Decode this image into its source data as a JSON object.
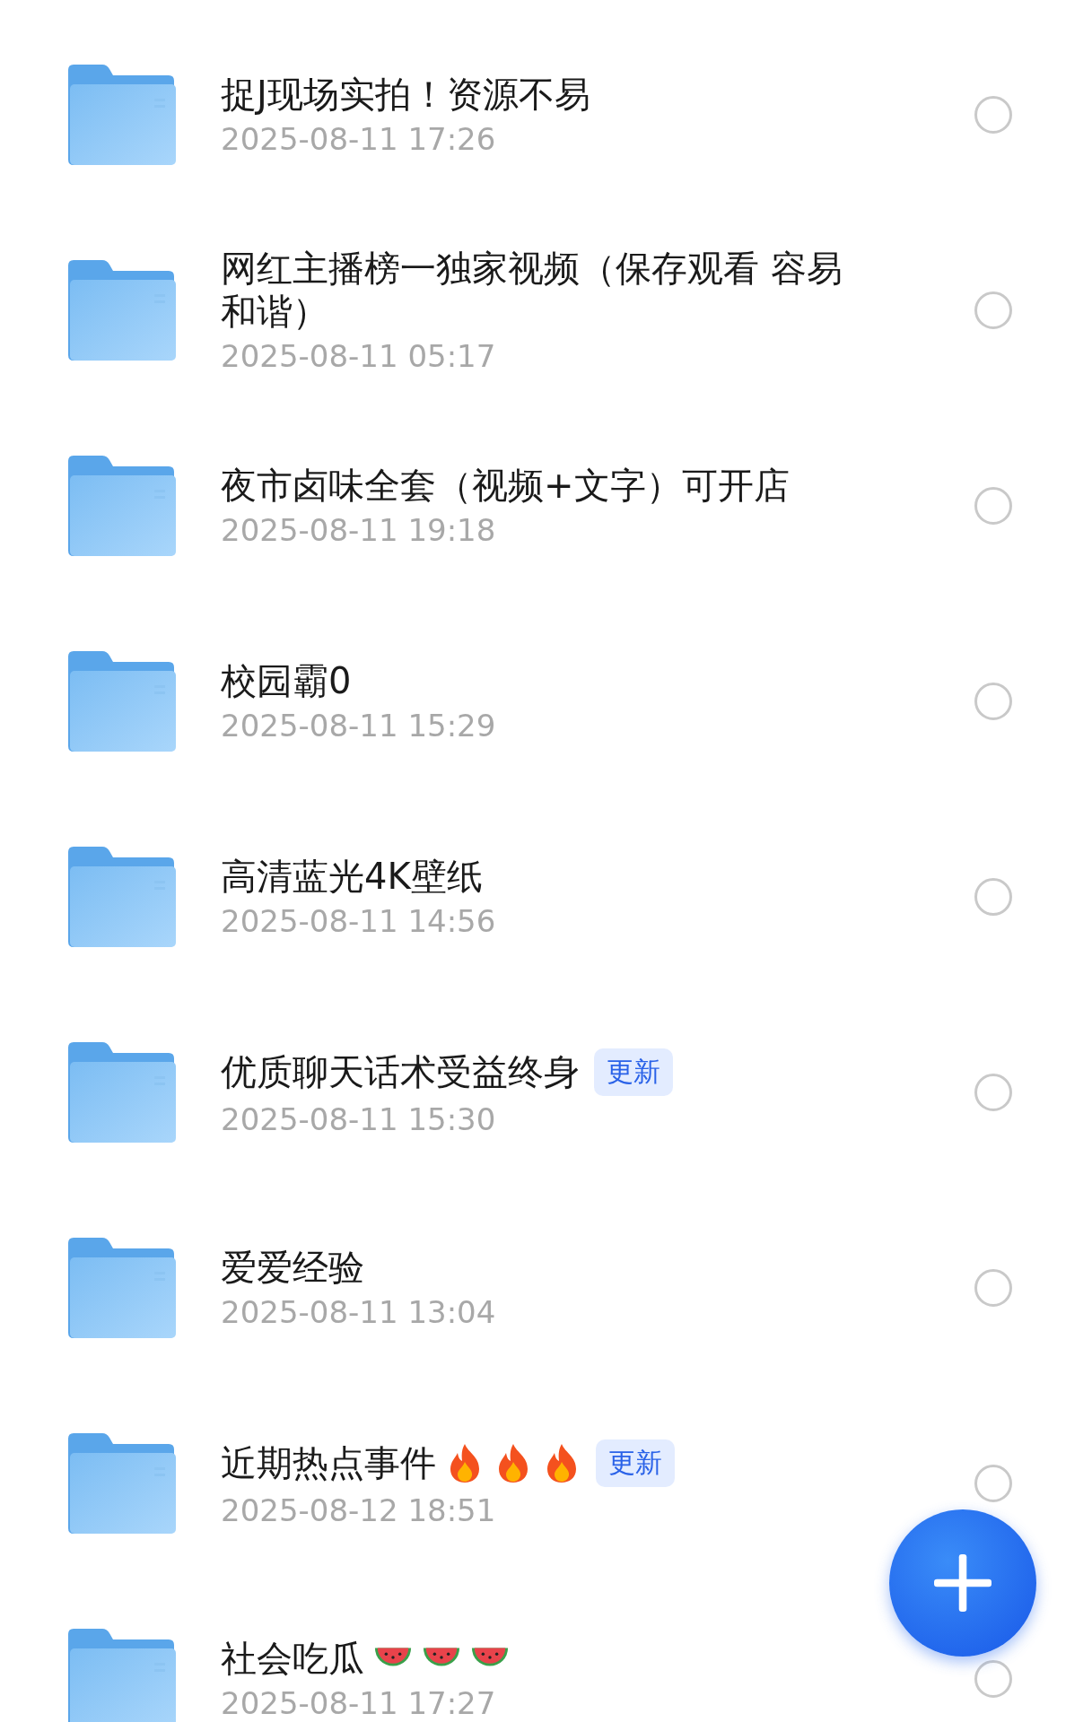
{
  "files": [
    {
      "title": "捉J现场实拍！资源不易",
      "date": "2025-08-11 17:26",
      "selected": false
    },
    {
      "title": "网红主播榜一独家视频（保存观看 容易和谐）",
      "date": "2025-08-11 05:17",
      "selected": false
    },
    {
      "title": "夜市卤味全套（视频+文字）可开店",
      "date": "2025-08-11 19:18",
      "selected": false
    },
    {
      "title": "校园霸0",
      "date": "2025-08-11 15:29",
      "selected": false
    },
    {
      "title": "高清蓝光4K壁纸",
      "date": "2025-08-11 14:56",
      "selected": false
    },
    {
      "title": "优质聊天话术受益终身",
      "badge": "更新",
      "date": "2025-08-11 15:30",
      "selected": false
    },
    {
      "title": "爱爱经验",
      "date": "2025-08-11 13:04",
      "selected": false
    },
    {
      "title": "近期热点事件",
      "icons": [
        {
          "kind": "fire"
        },
        {
          "kind": "fire"
        },
        {
          "kind": "fire"
        }
      ],
      "badge": "更新",
      "date": "2025-08-12 18:51",
      "selected": false
    },
    {
      "title": "社会吃瓜",
      "icons": [
        {
          "kind": "watermelon"
        },
        {
          "kind": "watermelon"
        },
        {
          "kind": "watermelon"
        }
      ],
      "date": "2025-08-11 17:27",
      "selected": false
    }
  ]
}
